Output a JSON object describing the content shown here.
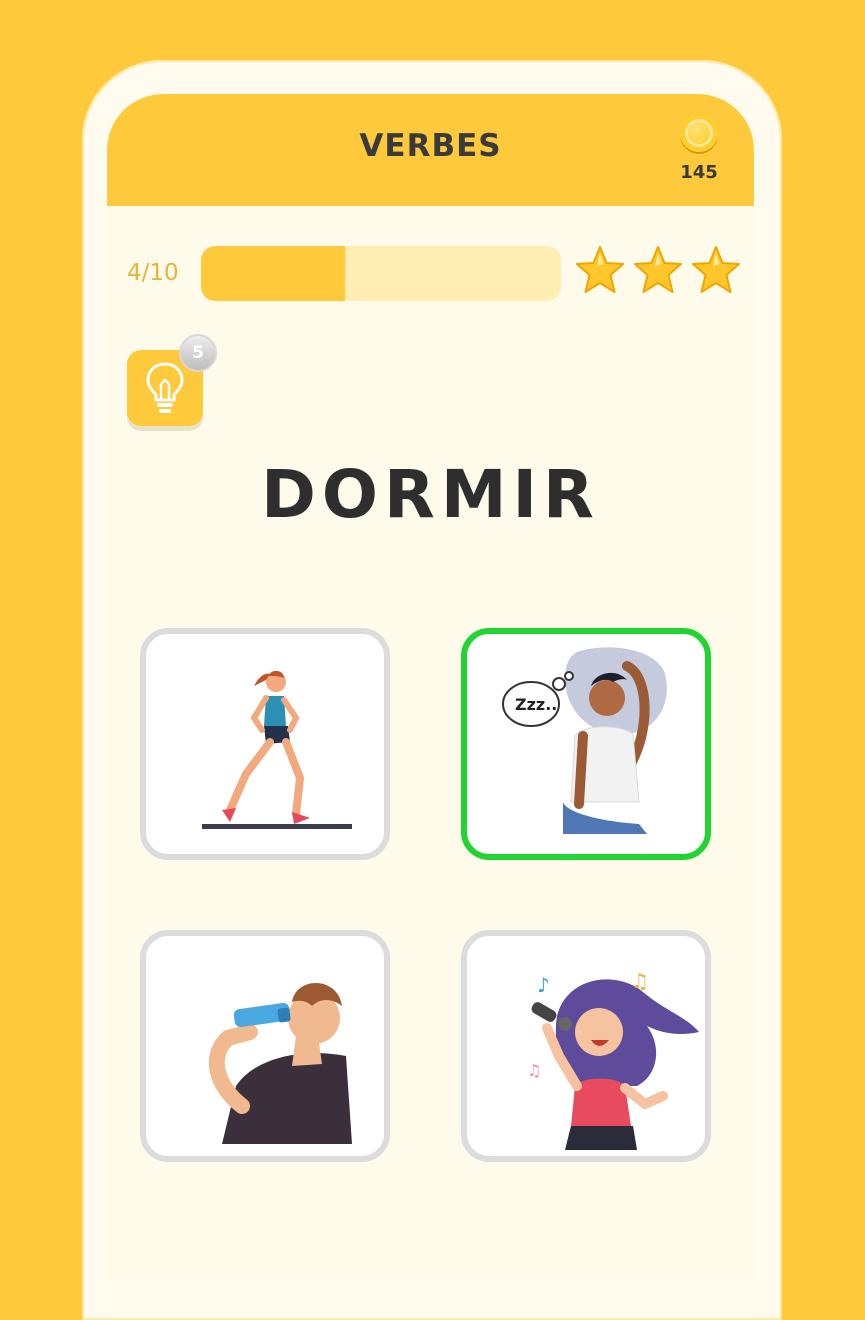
{
  "header": {
    "title": "VERBES",
    "coins": "145"
  },
  "progress": {
    "label": "4/10",
    "value": 0.4
  },
  "stars": {
    "count": 3,
    "icon": "star-icon"
  },
  "hint": {
    "cost": "5",
    "icon": "lightbulb-icon"
  },
  "question": {
    "word": "DORMIR"
  },
  "options": [
    {
      "icon": "running-woman-image",
      "selected": false
    },
    {
      "icon": "sleeping-man-image",
      "selected": true
    },
    {
      "icon": "drinking-man-image",
      "selected": false
    },
    {
      "icon": "singing-woman-image",
      "selected": false
    }
  ],
  "colors": {
    "accent": "#FFC93C",
    "background": "#FEFBEB",
    "selected_border": "#21D431",
    "card_border": "#DCDCDC"
  }
}
